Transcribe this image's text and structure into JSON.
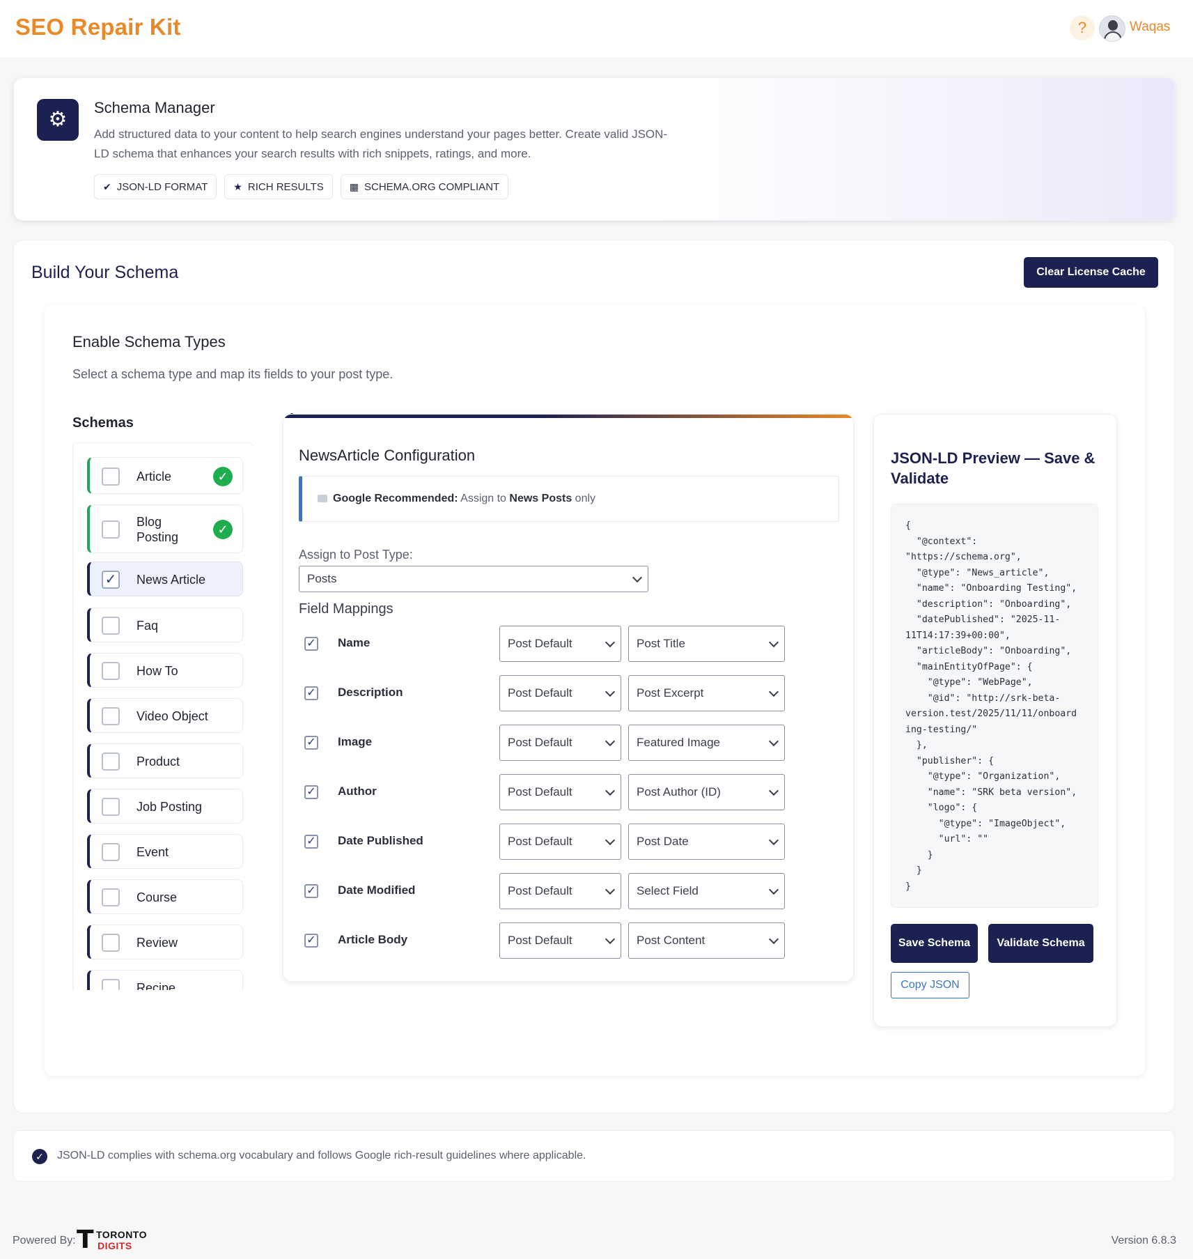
{
  "app": {
    "brand": "SEO Repair Kit",
    "help_glyph": "?",
    "user_name": "Waqas"
  },
  "hero": {
    "title": "Schema Manager",
    "description": "Add structured data to your content to help search engines understand your pages better. Create valid JSON-LD schema that enhances your search results with rich snippets, ratings, and more.",
    "chips": [
      {
        "label": "JSON-LD FORMAT",
        "icon": "check-circle-icon"
      },
      {
        "label": "RICH RESULTS",
        "icon": "star-icon"
      },
      {
        "label": "SCHEMA.ORG COMPLIANT",
        "icon": "grid-icon"
      }
    ]
  },
  "build": {
    "title": "Build Your Schema",
    "clear_cache_label": "Clear License Cache",
    "enable_title": "Enable Schema Types",
    "enable_subtitle": "Select a schema type and map its fields to your post type.",
    "schemas_title": "Schemas",
    "schemas": [
      {
        "label": "Article",
        "checked": false,
        "configured": true
      },
      {
        "label": "Blog Posting",
        "checked": false,
        "configured": true
      },
      {
        "label": "News Article",
        "checked": true,
        "configured": false,
        "active": true
      },
      {
        "label": "Faq",
        "checked": false,
        "configured": false
      },
      {
        "label": "How To",
        "checked": false,
        "configured": false
      },
      {
        "label": "Video Object",
        "checked": false,
        "configured": false
      },
      {
        "label": "Product",
        "checked": false,
        "configured": false
      },
      {
        "label": "Job Posting",
        "checked": false,
        "configured": false
      },
      {
        "label": "Event",
        "checked": false,
        "configured": false
      },
      {
        "label": "Course",
        "checked": false,
        "configured": false
      },
      {
        "label": "Review",
        "checked": false,
        "configured": false
      },
      {
        "label": "Recipe",
        "checked": false,
        "configured": false
      }
    ]
  },
  "config": {
    "title": "NewsArticle Configuration",
    "note_strong": "Google Recommended:",
    "note_mid": "Assign to",
    "note_post": "News Posts",
    "note_end": "only",
    "assign_label": "Assign to Post Type:",
    "assign_value": "Posts",
    "field_mappings_title": "Field Mappings",
    "fields": [
      {
        "name": "Name",
        "source": "Post Default",
        "field": "Post Title",
        "checked": true
      },
      {
        "name": "Description",
        "source": "Post Default",
        "field": "Post Excerpt",
        "checked": true
      },
      {
        "name": "Image",
        "source": "Post Default",
        "field": "Featured Image",
        "checked": true
      },
      {
        "name": "Author",
        "source": "Post Default",
        "field": "Post Author (ID)",
        "checked": true
      },
      {
        "name": "Date Published",
        "source": "Post Default",
        "field": "Post Date",
        "checked": true
      },
      {
        "name": "Date Modified",
        "source": "Post Default",
        "field": "Select Field",
        "checked": true
      },
      {
        "name": "Article Body",
        "source": "Post Default",
        "field": "Post Content",
        "checked": true
      }
    ]
  },
  "preview": {
    "title": "JSON-LD Preview — Save & Validate",
    "json": "{\n  \"@context\":\n\"https://schema.org\",\n  \"@type\": \"News_article\",\n  \"name\": \"Onboarding Testing\",\n  \"description\": \"Onboarding\",\n  \"datePublished\": \"2025-11-\n11T14:17:39+00:00\",\n  \"articleBody\": \"Onboarding\",\n  \"mainEntityOfPage\": {\n    \"@type\": \"WebPage\",\n    \"@id\": \"http://srk-beta-\nversion.test/2025/11/11/onboard\ning-testing/\"\n  },\n  \"publisher\": {\n    \"@type\": \"Organization\",\n    \"name\": \"SRK beta version\",\n    \"logo\": {\n      \"@type\": \"ImageObject\",\n      \"url\": \"\"\n    }\n  }\n}",
    "save_label": "Save Schema",
    "validate_label": "Validate Schema",
    "copy_label": "Copy JSON"
  },
  "compliance": {
    "text": "JSON-LD complies with schema.org vocabulary and follows Google rich-result guidelines where applicable."
  },
  "footer": {
    "powered_by": "Powered By:",
    "logo_letter": "T",
    "logo_line1": "TORONTO",
    "logo_line2": "DIGITS",
    "version": "Version 6.8.3"
  },
  "colors": {
    "brand_orange": "#e8892a",
    "navy": "#1b2150",
    "success_green": "#1fae4f",
    "link_blue": "#3a76c8"
  }
}
